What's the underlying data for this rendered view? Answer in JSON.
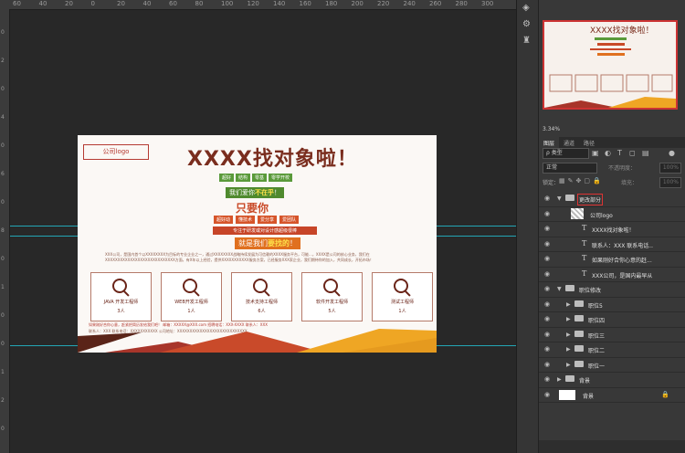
{
  "ruler": {
    "top_ticks": [
      "60",
      "40",
      "20",
      "0",
      "20",
      "40",
      "60",
      "80",
      "100",
      "120",
      "140",
      "160",
      "180",
      "200",
      "220",
      "240",
      "260",
      "280",
      "300"
    ],
    "left_ticks": [
      "0",
      "2",
      "0",
      "4",
      "0",
      "6",
      "0",
      "8",
      "0",
      "1",
      "0",
      "0",
      "1",
      "2",
      "0"
    ]
  },
  "document": {
    "logo": "公司logo",
    "title": "XXXX找对象啦！",
    "tags": [
      "超好",
      "结构",
      "零基",
      "零学开校"
    ],
    "green_bar": {
      "prefix": "我们爱你",
      "highlight": "不在乎",
      "suffix": "！"
    },
    "only_you": "只要你",
    "orange_tags": [
      "超好动",
      "懂技术",
      "爱分享",
      "爱团队"
    ],
    "red_bar": "专注于研发或对设计感超级很棒",
    "orange_bar": {
      "prefix": "就是我们",
      "highlight": "要找的",
      "suffix": "！"
    },
    "intro": "XXX公司，是国内首个以XXXXXXXX为目标的专业企业之一，通过XXXXXXXX战略持续发展为可信赖的XXXX服务平台，可能...，XXXX是公司的核心业务，我们在XXXXXXXXXXXXXXXXXXXXXXXXXXXX方面，有X年以上经验，提供XXXXXXXXXXX服务方案，已经服务XXX家企业，我们期待你的加入，共同成长，开拓市场！",
    "cards": [
      {
        "title": "JAVA 开发工程师",
        "count": "3人"
      },
      {
        "title": "WEB开发工程师",
        "count": "1人"
      },
      {
        "title": "技术支持工程师",
        "count": "6人"
      },
      {
        "title": "软件开发工程师",
        "count": "5人"
      },
      {
        "title": "测试工程师",
        "count": "1人"
      }
    ],
    "contact_line1": "如果刚好合你心意，赶紧把简历发给我们吧！ 邮箱：XXXXX@XXX.com  招聘电话：XXX-XXXX  联系人：XXX",
    "contact_line2": "联系人：XXX  联系电话：XXXXXXXXXXX  公司地址：XXXXXXXXXXXXXXXXXXXXXXXXXXXX"
  },
  "colors": {
    "brand_red": "#b53a32",
    "brown": "#7a2d1e",
    "orange": "#e0701f",
    "yellow": "#efa624",
    "green": "#4f8a2e",
    "guide": "#22c6d8"
  },
  "side_strip": {
    "icons": [
      "layers-comps-icon",
      "adjust-icon",
      "stamp-icon"
    ]
  },
  "panel": {
    "zoom": "3.34%",
    "tabs": [
      "图层",
      "通道",
      "路径"
    ],
    "filter_kind": "ρ 类型",
    "filter_icons": [
      "image-filter-icon",
      "adjust-filter-icon",
      "type-filter-icon",
      "shape-filter-icon",
      "smart-filter-icon",
      "toggle-filter-icon"
    ],
    "blend_mode": "正常",
    "opacity_label": "不透明度：",
    "opacity_value": "100%",
    "lock_label": "锁定：",
    "fill_label": "填充：",
    "fill_value": "100%",
    "layers": [
      {
        "name": "更改部分",
        "type": "group",
        "expanded": true,
        "indent": 0,
        "selected": true
      },
      {
        "name": "公司logo",
        "type": "smart",
        "indent": 1
      },
      {
        "name": "XXXX找对象啦！",
        "type": "text",
        "indent": 1
      },
      {
        "name": "联系人：XXX  联系电话...",
        "type": "text",
        "indent": 1
      },
      {
        "name": "如果刚好合你心意的赶...",
        "type": "text",
        "indent": 1
      },
      {
        "name": "XXX公司，是国内最早从...",
        "type": "text",
        "indent": 1
      },
      {
        "name": "职位修改",
        "type": "group",
        "expanded": true,
        "indent": 0
      },
      {
        "name": "职位5",
        "type": "group",
        "expanded": false,
        "indent": 1
      },
      {
        "name": "职位四",
        "type": "group",
        "expanded": false,
        "indent": 1
      },
      {
        "name": "职位三",
        "type": "group",
        "expanded": false,
        "indent": 1
      },
      {
        "name": "职位二",
        "type": "group",
        "expanded": false,
        "indent": 1
      },
      {
        "name": "职位一",
        "type": "group",
        "expanded": false,
        "indent": 1
      },
      {
        "name": "背景",
        "type": "group",
        "expanded": false,
        "indent": 0
      },
      {
        "name": "背景",
        "type": "background",
        "indent": 0,
        "locked": true
      }
    ]
  }
}
